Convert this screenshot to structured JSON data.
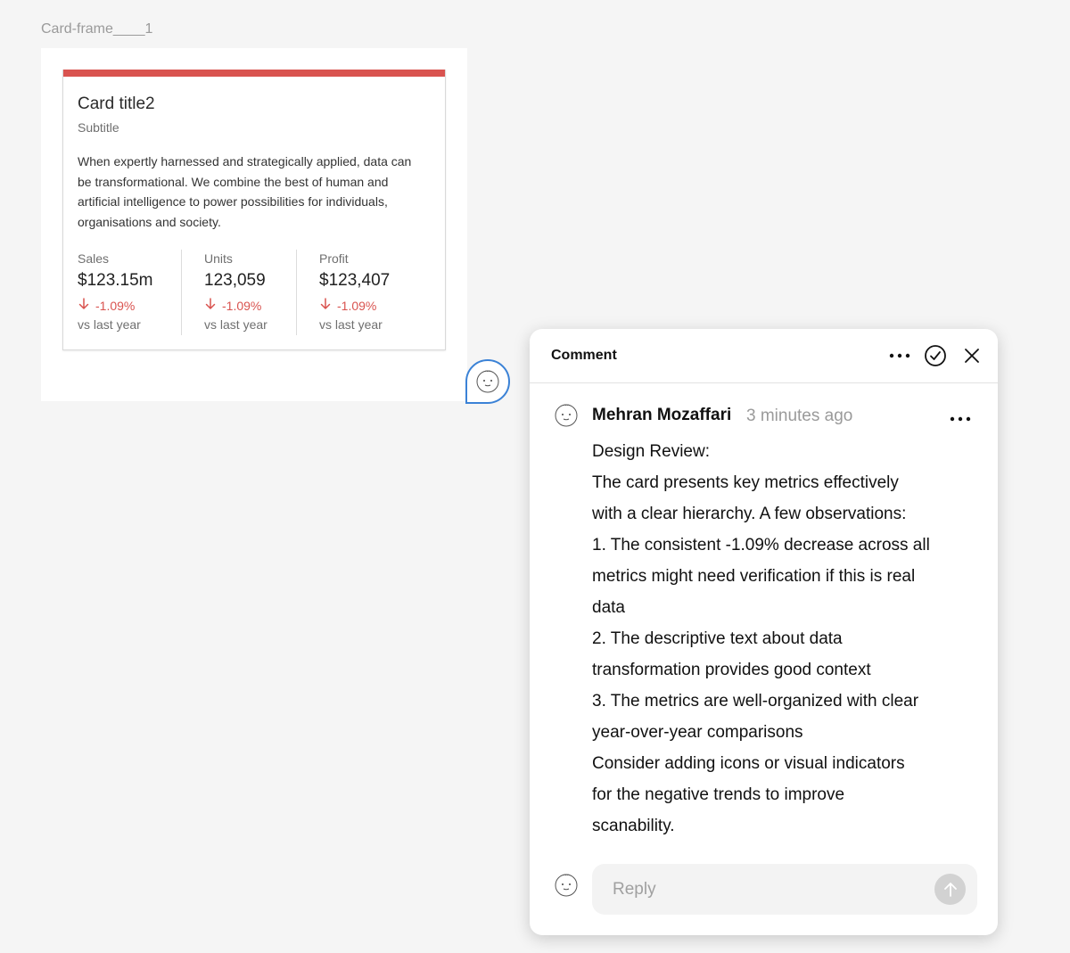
{
  "frame": {
    "label": "Card-frame____1"
  },
  "card": {
    "accent_color": "#d9534f",
    "title": "Card title2",
    "subtitle": "Subtitle",
    "body": "When expertly harnessed and strategically applied, data can be transformational. We combine the best of human and artificial intelligence to power possibilities for individuals, organisations and society.",
    "metrics": [
      {
        "label": "Sales",
        "value": "$123.15m",
        "change": "-1.09%",
        "compare": "vs last year"
      },
      {
        "label": "Units",
        "value": "123,059",
        "change": "-1.09%",
        "compare": "vs last year"
      },
      {
        "label": "Profit",
        "value": "$123,407",
        "change": "-1.09%",
        "compare": "vs last year"
      }
    ]
  },
  "comment_panel": {
    "title": "Comment",
    "icons": {
      "more": "more-horizontal-icon",
      "resolve": "check-circle-icon",
      "close": "close-icon",
      "send": "arrow-up-icon"
    },
    "author": "Mehran Mozaffari",
    "timestamp": "3 minutes ago",
    "body_lines": [
      "Design Review:",
      "The card presents key metrics effectively",
      "with a clear hierarchy. A few observations:",
      "1. The consistent -1.09% decrease across all",
      "metrics might need verification if this is real",
      "data",
      "2. The descriptive text about data",
      "transformation provides good context",
      "3. The metrics are well-organized with clear",
      "year-over-year comparisons",
      "Consider adding icons or visual indicators",
      "for the negative trends to improve",
      "scanability."
    ],
    "reply_placeholder": "Reply",
    "pin_color": "#3b82d6"
  }
}
